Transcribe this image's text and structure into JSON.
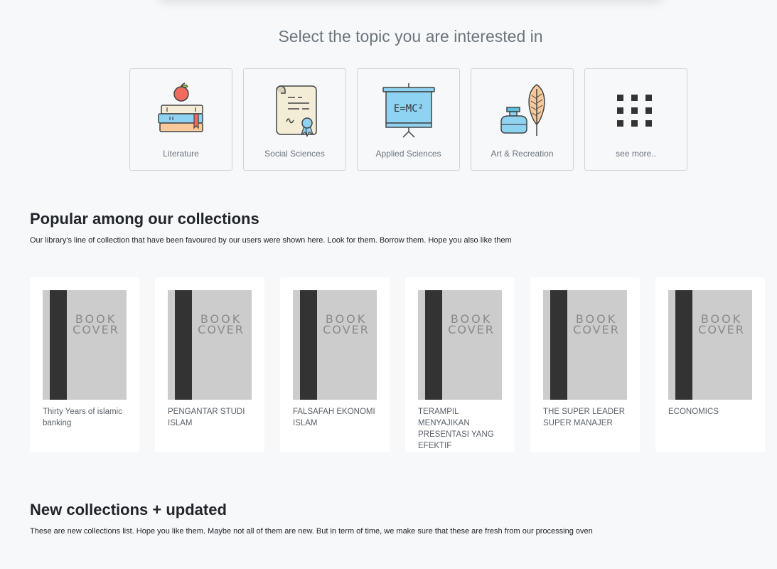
{
  "topics": {
    "heading": "Select the topic you are interested in",
    "items": [
      {
        "key": "literature",
        "label": "Literature",
        "icon": "books-apple-icon"
      },
      {
        "key": "social-sciences",
        "label": "Social Sciences",
        "icon": "certificate-scroll-icon"
      },
      {
        "key": "applied-sciences",
        "label": "Applied Sciences",
        "icon": "projector-board-icon"
      },
      {
        "key": "art-recreation",
        "label": "Art & Recreation",
        "icon": "ink-feather-icon"
      },
      {
        "key": "see-more",
        "label": "see more..",
        "icon": "grid-icon"
      }
    ]
  },
  "popular": {
    "title": "Popular among our collections",
    "description": "Our library's line of collection that have been favoured by our users were shown here. Look for them. Borrow them. Hope you also like them",
    "cover_text_line1": "BOOK",
    "cover_text_line2": "COVER",
    "books": [
      {
        "title": "Thirty Years of islamic banking"
      },
      {
        "title": "PENGANTAR STUDI ISLAM"
      },
      {
        "title": "FALSAFAH EKONOMI ISLAM"
      },
      {
        "title": "TERAMPIL MENYAJIKAN PRESENTASI YANG EFEKTIF"
      },
      {
        "title": "THE SUPER LEADER SUPER MANAJER"
      },
      {
        "title": "ECONOMICS"
      }
    ]
  },
  "new_collections": {
    "title": "New collections + updated",
    "description": "These are new collections list. Hope you like them. Maybe not all of them are new. But in term of time, we make sure that these are fresh from our processing oven"
  },
  "icon_text": {
    "formula": "E=MC²"
  },
  "colors": {
    "background": "#f7f8fa",
    "card_border": "#cfd3d7",
    "muted_text": "#6c757d",
    "cover_gray": "#cccccc",
    "cover_spine": "#333333"
  }
}
